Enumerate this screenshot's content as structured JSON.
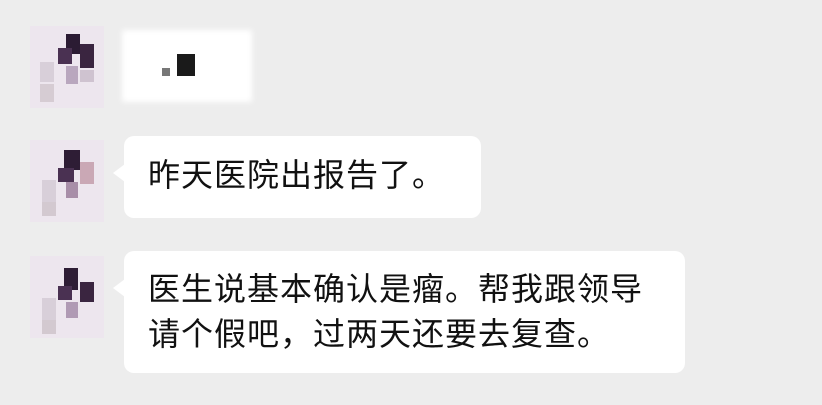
{
  "chat": {
    "messages": [
      {
        "text": ""
      },
      {
        "text": "昨天医院出报告了。"
      },
      {
        "text": "医生说基本确认是瘤。帮我跟领导\n请个假吧，过两天还要去复查。"
      }
    ]
  },
  "colors": {
    "background": "#ededed",
    "bubble": "#ffffff",
    "text": "#111111"
  }
}
